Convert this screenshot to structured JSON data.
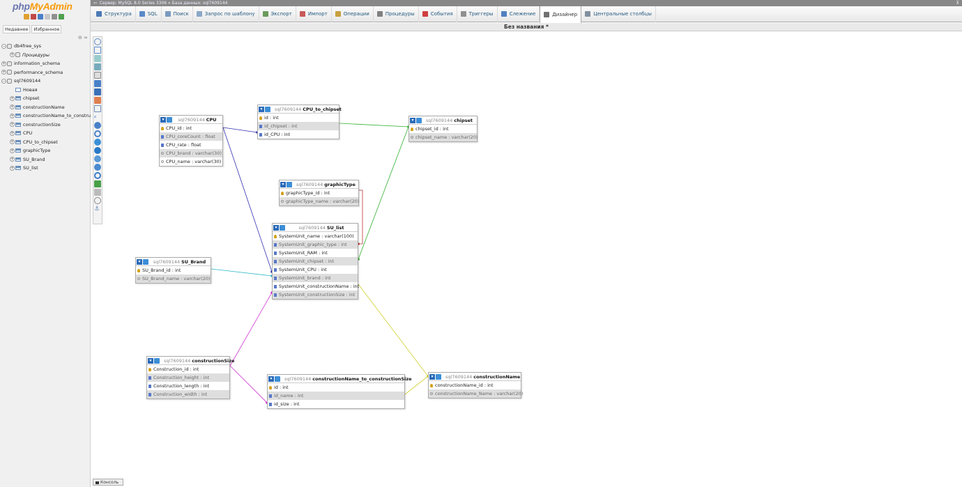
{
  "sidebar": {
    "logo": {
      "part1": "php",
      "part2": "My",
      "part3": "Admin"
    },
    "tabs": [
      "Недавнее",
      "Избранное"
    ],
    "tree": [
      {
        "label": "db4free_sys",
        "type": "db",
        "indent": 0
      },
      {
        "label": "Процедуры",
        "type": "proc",
        "indent": 1
      },
      {
        "label": "information_schema",
        "type": "db",
        "indent": 0
      },
      {
        "label": "performance_schema",
        "type": "db",
        "indent": 0
      },
      {
        "label": "sql7609144",
        "type": "db",
        "indent": 0
      },
      {
        "label": "Новая",
        "type": "new",
        "indent": 1
      },
      {
        "label": "chipset",
        "type": "table",
        "indent": 1
      },
      {
        "label": "constructionName",
        "type": "table",
        "indent": 1
      },
      {
        "label": "constructionName_to_constru",
        "type": "table",
        "indent": 1
      },
      {
        "label": "constructionSize",
        "type": "table",
        "indent": 1
      },
      {
        "label": "CPU",
        "type": "table",
        "indent": 1
      },
      {
        "label": "CPU_to_chipset",
        "type": "table",
        "indent": 1
      },
      {
        "label": "graphicType",
        "type": "table",
        "indent": 1
      },
      {
        "label": "SU_Brand",
        "type": "table",
        "indent": 1
      },
      {
        "label": "SU_list",
        "type": "table",
        "indent": 1
      }
    ]
  },
  "serverbar": {
    "server": "Сервер: MySQL 8.0 Series 3306",
    "sep": "»",
    "database": "База данных: sql7609144"
  },
  "menu": [
    {
      "label": "Структура",
      "color": "#4a7ab5"
    },
    {
      "label": "SQL",
      "color": "#5a8ac8"
    },
    {
      "label": "Поиск",
      "color": "#7a9ac0"
    },
    {
      "label": "Запрос по шаблону",
      "color": "#8aa8c8"
    },
    {
      "label": "Экспорт",
      "color": "#6a9a5a"
    },
    {
      "label": "Импорт",
      "color": "#c85a5a"
    },
    {
      "label": "Операции",
      "color": "#c8a040"
    },
    {
      "label": "Процедуры",
      "color": "#808080"
    },
    {
      "label": "События",
      "color": "#d04040"
    },
    {
      "label": "Триггеры",
      "color": "#909090"
    },
    {
      "label": "Слежение",
      "color": "#5080c0"
    },
    {
      "label": "Дизайнер",
      "color": "#707070",
      "active": true
    },
    {
      "label": "Центральные столбцы",
      "color": "#8090a0"
    }
  ],
  "designer": {
    "title": "Без названия *"
  },
  "console": {
    "label": "Консоль"
  },
  "db": "sql7609144",
  "tables": {
    "cpu": {
      "name": "CPU",
      "cols": [
        "CPU_id : int",
        "CPU_coreCount : float",
        "CPU_rate : float",
        "CPU_brand : varchar(30)",
        "CPU_name : varchar(30)"
      ]
    },
    "cpu_to_chipset": {
      "name": "CPU_to_chipset",
      "cols": [
        "id : int",
        "id_chipset : int",
        "id_CPU : int"
      ]
    },
    "chipset": {
      "name": "chipset",
      "cols": [
        "chipset_id : int",
        "chipset_name : varchar(20)"
      ]
    },
    "graphictype": {
      "name": "graphicType",
      "cols": [
        "graphicType_id : int",
        "graphicType_name : varchar(20)"
      ]
    },
    "su_list": {
      "name": "SU_list",
      "cols": [
        "SystemUnit_name : varchar(100)",
        "SystemUnit_graphic_type : int",
        "SystemUnit_RAM : int",
        "SystemUnit_chipset : int",
        "SystemUnit_CPU : int",
        "SystemUnit_brand : int",
        "SystemUnit_constructionName : int",
        "SystemUnit_constructionSize : int"
      ]
    },
    "su_brand": {
      "name": "SU_Brand",
      "cols": [
        "SU_Brand_id : int",
        "SU_Brand_name : varchar(20)"
      ]
    },
    "constructionsize": {
      "name": "constructionSize",
      "cols": [
        "Construction_id : int",
        "Construction_height : int",
        "Construction_length : int",
        "Construction_width : int"
      ]
    },
    "cn_to_cs": {
      "name": "constructionName_to_constructionSize",
      "cols": [
        "id : int",
        "id_name : int",
        "id_size : int"
      ]
    },
    "constructionname": {
      "name": "constructionName",
      "cols": [
        "constructionName_id : int",
        "constructionName_Name : varchar(20)"
      ]
    }
  },
  "link_colors": {
    "cpu_links": "#3030b0",
    "chipset_links": "#30b030",
    "graphic_link": "#c03030",
    "brand_link": "#30b8c8",
    "size_links": "#d030d0",
    "name_links": "#d0d030"
  }
}
